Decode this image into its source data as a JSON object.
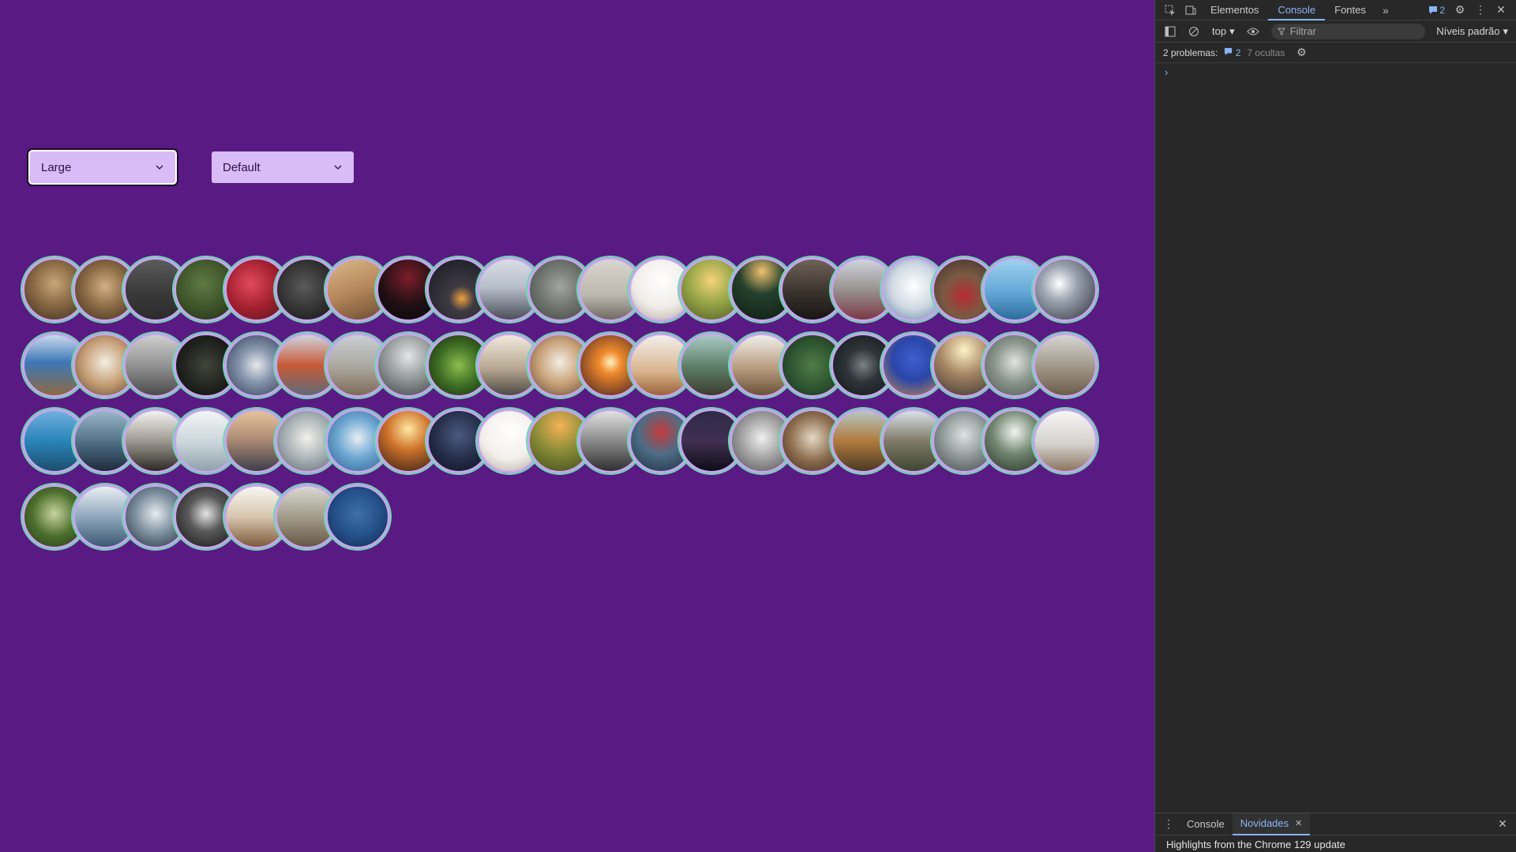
{
  "controls": {
    "size_select": {
      "value": "Large"
    },
    "variant_select": {
      "value": "Default"
    }
  },
  "avatar_rows": [
    [
      {
        "name": "avatar-arches",
        "bg": "radial-gradient(circle at 50% 40%, #c9a679 0%, #8a6a45 45%, #3b2c1e 100%)"
      },
      {
        "name": "avatar-arches",
        "bg": "radial-gradient(circle at 50% 45%, #d4b083 0%, #8d6c47 45%, #3a2c1f 100%)"
      },
      {
        "name": "avatar-wall-shelf",
        "bg": "linear-gradient(180deg, #5b5b5b 0%, #3a3a3a 55%, #2b2b2b 100%)"
      },
      {
        "name": "avatar-ivy",
        "bg": "radial-gradient(circle at 45% 40%, #5f7a44 0%, #3b5128 55%, #1f2c15 100%)"
      },
      {
        "name": "avatar-strawberries",
        "bg": "radial-gradient(circle at 40% 40%, #e24a5c 0%, #a11f2f 50%, #4e1a1f 100%)"
      },
      {
        "name": "avatar-dark-texture",
        "bg": "radial-gradient(circle at 45% 45%, #5a5a5a 0%, #303030 55%, #141414 100%)"
      },
      {
        "name": "avatar-wood-desk",
        "bg": "linear-gradient(160deg, #d9b98a 0%, #b6875a 50%, #6a4b33 100%)"
      },
      {
        "name": "avatar-dark-red",
        "bg": "radial-gradient(circle at 50% 30%, #7a1e2a 0%, #1e0f13 55%, #0a0a0a 100%)"
      },
      {
        "name": "avatar-night-light",
        "bg": "radial-gradient(circle at 55% 65%, #f0a040 0%, #3d3a42 25%, #161922 100%)"
      },
      {
        "name": "avatar-city-skyline",
        "bg": "linear-gradient(180deg, #d9dce4 0%, #b8c0cc 45%, #4b4f5a 100%)"
      },
      {
        "name": "avatar-wolf",
        "bg": "radial-gradient(circle at 50% 45%, #a3a5a2 0%, #6d726d 50%, #3f4640 100%)"
      },
      {
        "name": "avatar-foggy-bridge",
        "bg": "linear-gradient(180deg, #d9d6d0 0%, #bcb7ad 60%, #6f6a62 100%)"
      },
      {
        "name": "avatar-palm-tree",
        "bg": "radial-gradient(circle at 50% 35%, #ffffff 0%, #f0ece8 55%, #b2a89c 100%)"
      },
      {
        "name": "avatar-sunset-field",
        "bg": "radial-gradient(circle at 50% 35%, #f6d27a 0%, #9aa849 45%, #4d5a22 100%)"
      },
      {
        "name": "avatar-forest-dark",
        "bg": "radial-gradient(circle at 50% 20%, #f0c070 0%, #24412c 40%, #0f1d14 100%)"
      },
      {
        "name": "avatar-rail-dusk",
        "bg": "linear-gradient(180deg, #6e6258 0%, #3a322d 55%, #171514 100%)"
      },
      {
        "name": "avatar-railroad",
        "bg": "linear-gradient(180deg, #cfd4de 0%, #98928f 50%, #7a3946 100%)"
      },
      {
        "name": "avatar-santorini",
        "bg": "radial-gradient(circle at 50% 45%, #ffffff 0%, #cfd9e3 50%, #5b7ba0 100%)"
      },
      {
        "name": "avatar-woman-red",
        "bg": "radial-gradient(circle at 50% 60%, #b82c31 0%, #7a5a44 45%, #3b2e28 100%)"
      },
      {
        "name": "avatar-seagull",
        "bg": "linear-gradient(180deg, #9ed0ef 0%, #62a8d6 55%, #2b6c9c 100%)"
      },
      {
        "name": "avatar-chrome-ball",
        "bg": "radial-gradient(circle at 40% 40%, #ffffff 0%, #9aa3b0 35%, #2b2f38 100%)"
      }
    ],
    [
      {
        "name": "avatar-coast-cliffs",
        "bg": "linear-gradient(180deg, #c7d9ec 0%, #3e77b7 45%, #8d6a42 100%)"
      },
      {
        "name": "avatar-city-street",
        "bg": "radial-gradient(circle at 50% 45%, #f4eee3 0%, #c69f76 50%, #5a4334 100%)"
      },
      {
        "name": "avatar-grey-stairs",
        "bg": "linear-gradient(180deg, #cfcfcf 0%, #8c8c8c 55%, #4a4a4a 100%)"
      },
      {
        "name": "avatar-night-field",
        "bg": "radial-gradient(circle at 50% 50%, #41463a 0%, #20221e 55%, #0d0e0c 100%)"
      },
      {
        "name": "avatar-laptop-hands",
        "bg": "radial-gradient(circle at 50% 50%, #e6e8ec 0%, #8796ad 40%, #2d3a50 100%)"
      },
      {
        "name": "avatar-golden-gate",
        "bg": "linear-gradient(180deg, #cfd3dc 0%, #c85a38 50%, #5f6a78 100%)"
      },
      {
        "name": "avatar-beach-fog",
        "bg": "linear-gradient(180deg, #c9ced3 0%, #a9a59d 55%, #7e6a56 100%)"
      },
      {
        "name": "avatar-misty-mountain",
        "bg": "radial-gradient(circle at 50% 35%, #e3e5e6 0%, #8e9394 50%, #3c4243 100%)"
      },
      {
        "name": "avatar-fern",
        "bg": "radial-gradient(circle at 50% 50%, #8cbc4d 0%, #3d6b24 50%, #15250d 100%)"
      },
      {
        "name": "avatar-bicycle",
        "bg": "linear-gradient(180deg, #f1e9dc 0%, #b7a792 55%, #4d4a44 100%)"
      },
      {
        "name": "avatar-city-street-2",
        "bg": "radial-gradient(circle at 50% 45%, #f4eee3 0%, #c69f76 50%, #5a4334 100%)"
      },
      {
        "name": "avatar-sparkler",
        "bg": "radial-gradient(circle at 50% 45%, #fff1c2 0%, #f08a2c 25%, #3a1a22 100%)"
      },
      {
        "name": "avatar-desert-dune",
        "bg": "linear-gradient(180deg, #f2efec 0%, #d9b48e 60%, #9b6239 100%)"
      },
      {
        "name": "avatar-green-hill",
        "bg": "linear-gradient(180deg, #a9c9c4 0%, #5a7c64 55%, #3d3b2c 100%)"
      },
      {
        "name": "avatar-ploughed-field",
        "bg": "linear-gradient(180deg, #f0efea 0%, #b89b7e 55%, #6a5239 100%)"
      },
      {
        "name": "avatar-green-moss",
        "bg": "radial-gradient(circle at 50% 50%, #4f7d46 0%, #2d5330 55%, #17301a 100%)"
      },
      {
        "name": "avatar-coffee-plate",
        "bg": "radial-gradient(circle at 50% 50%, #7b8084 0%, #2e3439 40%, #121519 100%)"
      },
      {
        "name": "avatar-blue-rocks",
        "bg": "radial-gradient(circle at 50% 40%, #3f5fd0 0%, #2a46a8 45%, #c88a4a 100%)"
      },
      {
        "name": "avatar-train-platform",
        "bg": "radial-gradient(circle at 50% 25%, #fff3c7 0%, #a68664 45%, #3b3432 100%)"
      },
      {
        "name": "avatar-graffiti-park",
        "bg": "radial-gradient(circle at 50% 45%, #e1e4e1 0%, #8b968d 45%, #49534c 100%)"
      },
      {
        "name": "avatar-castle-road",
        "bg": "linear-gradient(180deg, #d7d6d2 0%, #9e9486 55%, #6c5c4a 100%)"
      }
    ],
    [
      {
        "name": "avatar-lake-mountains",
        "bg": "linear-gradient(180deg, #6fb0dd 0%, #2a83b8 50%, #1b4f6d 100%)"
      },
      {
        "name": "avatar-ocean-dusk",
        "bg": "linear-gradient(180deg, #9ab7c9 0%, #4c6a82 55%, #1d2c3a 100%)"
      },
      {
        "name": "avatar-rocky-shore",
        "bg": "linear-gradient(180deg, #f2f2f0 0%, #a7a39b 45%, #2d2a26 100%)"
      },
      {
        "name": "avatar-sea-horizon",
        "bg": "linear-gradient(180deg, #f3f5f6 0%, #c8d4da 55%, #8ea1aa 100%)"
      },
      {
        "name": "avatar-pier-sunset",
        "bg": "linear-gradient(180deg, #e5c39a 0%, #b08e76 45%, #3e3d4a 100%)"
      },
      {
        "name": "avatar-new-york",
        "bg": "radial-gradient(circle at 50% 45%, #f3f1ea 0%, #a7b0b5 50%, #596167 100%)"
      },
      {
        "name": "avatar-coastline-aerial",
        "bg": "radial-gradient(circle at 50% 45%, #e8eef2 0%, #6ea7d3 45%, #2b5d8b 100%)"
      },
      {
        "name": "avatar-sunset-tracks",
        "bg": "radial-gradient(circle at 50% 30%, #ffe7a0 0%, #d0742c 40%, #2e1a14 100%)"
      },
      {
        "name": "avatar-night-storm",
        "bg": "radial-gradient(circle at 50% 40%, #4b5a80 0%, #222b46 55%, #0f1220 100%)"
      },
      {
        "name": "avatar-palm-white",
        "bg": "radial-gradient(circle at 50% 35%, #ffffff 0%, #f3efeb 55%, #b4a99d 100%)"
      },
      {
        "name": "avatar-golden-meadow",
        "bg": "radial-gradient(circle at 50% 25%, #f4b257 0%, #8e8e38 45%, #3d4d1e 100%)"
      },
      {
        "name": "avatar-brooklyn-bridge",
        "bg": "linear-gradient(180deg, #e0e0e0 0%, #8a8a8a 50%, #2f2f2f 100%)"
      },
      {
        "name": "avatar-man-camera",
        "bg": "radial-gradient(circle at 50% 35%, #c33b3b 0%, #4e6d86 45%, #1c2e3e 100%)"
      },
      {
        "name": "avatar-night-building",
        "bg": "linear-gradient(180deg, #2e2a46 0%, #402f52 50%, #0f0c18 100%)"
      },
      {
        "name": "avatar-lighthouse",
        "bg": "radial-gradient(circle at 50% 45%, #f0f0f0 0%, #9c9c9c 50%, #4c4c4c 100%)"
      },
      {
        "name": "avatar-coffee-beans",
        "bg": "radial-gradient(circle at 50% 45%, #e5d8c5 0%, #8d6e4f 50%, #3d2b1d 100%)"
      },
      {
        "name": "avatar-autumn-hills",
        "bg": "linear-gradient(180deg, #b6c6c4 0%, #b07a3d 50%, #4b3a24 100%)"
      },
      {
        "name": "avatar-yosemite",
        "bg": "linear-gradient(180deg, #d8e0e6 0%, #7f7a68 50%, #3e4633 100%)"
      },
      {
        "name": "avatar-foggy-trees",
        "bg": "radial-gradient(circle at 50% 40%, #dfe4e4 0%, #8b9494 50%, #3f4747 100%)"
      },
      {
        "name": "avatar-waterfall",
        "bg": "radial-gradient(circle at 50% 35%, #f1f5f3 0%, #71866f 45%, #263225 100%)"
      },
      {
        "name": "avatar-misty-hill",
        "bg": "linear-gradient(180deg, #f6f6f6 0%, #d4d2cd 55%, #8b7560 100%)"
      }
    ],
    [
      {
        "name": "avatar-forest-path",
        "bg": "radial-gradient(circle at 50% 45%, #c8d49e 0%, #4d6f2d 50%, #24361a 100%)"
      },
      {
        "name": "avatar-fjord",
        "bg": "linear-gradient(180deg, #e9eef3 0%, #8fa7bd 50%, #3d5874 100%)"
      },
      {
        "name": "avatar-snowy-mountain",
        "bg": "radial-gradient(circle at 50% 45%, #e7ebee 0%, #7e91a0 45%, #1e2a36 100%)"
      },
      {
        "name": "avatar-guitarist",
        "bg": "radial-gradient(circle at 50% 45%, #e4e4e4 0%, #5a5a5a 40%, #101010 100%)"
      },
      {
        "name": "avatar-wooden-pier",
        "bg": "linear-gradient(180deg, #f8f6f2 0%, #d8c6ae 50%, #7d5b3d 100%)"
      },
      {
        "name": "avatar-castle-path",
        "bg": "linear-gradient(180deg, #d9d8d2 0%, #9d9584 55%, #655645 100%)"
      },
      {
        "name": "avatar-deep-ocean",
        "bg": "radial-gradient(circle at 50% 45%, #3f6fa6 0%, #25508a 50%, #0f2748 100%)"
      }
    ]
  ],
  "devtools": {
    "tabs": [
      "Elementos",
      "Console",
      "Fontes"
    ],
    "active_tab": "Console",
    "issues_badge": "2",
    "context": "top",
    "filter_placeholder": "Filtrar",
    "levels": "Níveis padrão",
    "issues_label": "2 problemas:",
    "issues_count": "2",
    "hidden_label": "7 ocultas",
    "drawer_tabs": [
      "Console",
      "Novidades"
    ],
    "drawer_active": "Novidades",
    "drawer_text": "Highlights from the Chrome 129 update"
  }
}
